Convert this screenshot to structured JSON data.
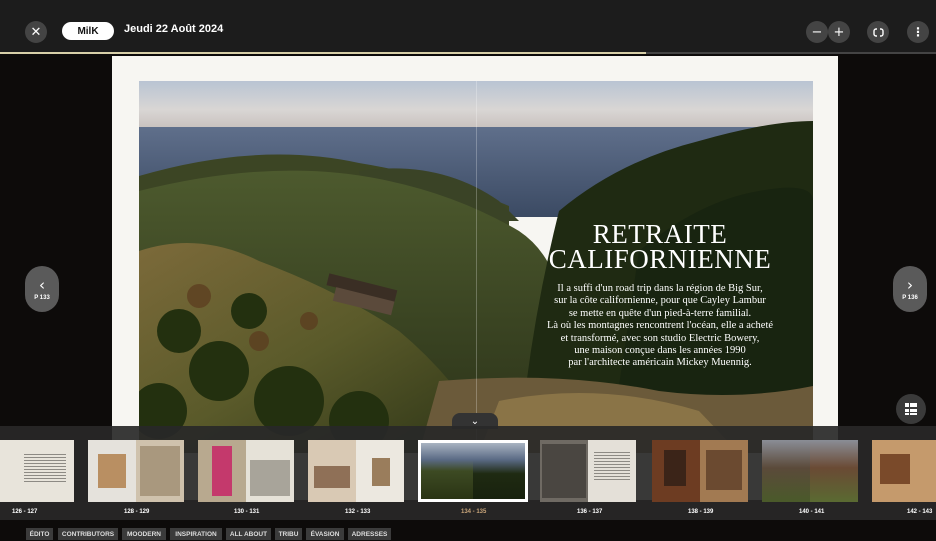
{
  "topbar": {
    "logo": "MilK",
    "date": "Jeudi 22 Août 2024",
    "close_icon": "close-icon",
    "zoom_out_icon": "minus-icon",
    "zoom_in_icon": "plus-icon",
    "fullscreen_icon": "fullscreen-icon",
    "menu_icon": "more-vertical-icon",
    "progress": 0.69
  },
  "article": {
    "headline_line1": "RETRAITE",
    "headline_line2": "CALIFORNIENNE",
    "lead_lines": [
      "Il a suffi d'un road trip dans la région de Big Sur,",
      "sur la côte californienne, pour que Cayley Lambur",
      "se mette en quête d'un pied-à-terre familial.",
      "Là où les montagnes rencontrent l'océan, elle a acheté",
      "et transformé, avec son studio Electric Bowery,",
      "une maison conçue dans les années 1990",
      "par l'architecte américain Mickey Muennig."
    ]
  },
  "nav": {
    "prev_label": "P 133",
    "next_label": "P 136"
  },
  "thumbnails": [
    {
      "label": "126 - 127"
    },
    {
      "label": "128 - 129"
    },
    {
      "label": "130 - 131"
    },
    {
      "label": "132 - 133"
    },
    {
      "label": "134 - 135",
      "active": true
    },
    {
      "label": "136 - 137"
    },
    {
      "label": "138 - 139"
    },
    {
      "label": "140 - 141"
    },
    {
      "label": "142 - 143"
    }
  ],
  "categories": [
    "ÉDITO",
    "CONTRIBUTORS",
    "MOODERN",
    "INSPIRATION",
    "ALL ABOUT",
    "TRIBU",
    "ÉVASION",
    "ADRESSES"
  ],
  "colors": {
    "topbar": "#1c1c1c",
    "accent": "#d7cfa8",
    "active_label": "#c9a57a"
  }
}
